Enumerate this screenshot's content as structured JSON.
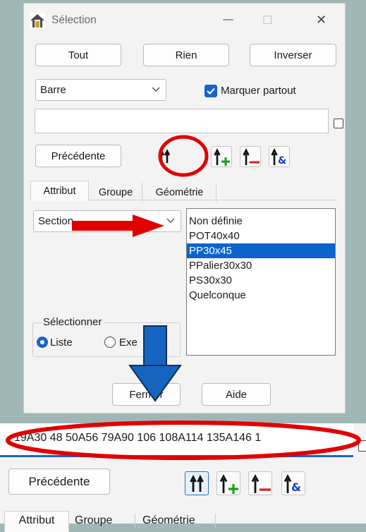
{
  "window": {
    "title": "Sélection",
    "controls": {
      "minimize": "—",
      "maximize": "☐",
      "close": "✕"
    }
  },
  "buttons": {
    "all": "Tout",
    "none": "Rien",
    "invert": "Inverser",
    "previous": "Précédente",
    "close": "Fermer",
    "help": "Aide"
  },
  "object_type": {
    "selected": "Barre"
  },
  "mark_everywhere": {
    "label": "Marquer partout",
    "checked": true
  },
  "selection_field": {
    "value": ""
  },
  "tabs": [
    {
      "label": "Attribut",
      "active": true
    },
    {
      "label": "Groupe",
      "active": false
    },
    {
      "label": "Géométrie",
      "active": false
    }
  ],
  "attribute": {
    "selected": "Section"
  },
  "values_list": {
    "items": [
      "Non définie",
      "POT40x40",
      "PP30x45",
      "PPalier30x30",
      "PS30x30",
      "Quelconque"
    ],
    "selected_index": 2
  },
  "select_mode": {
    "group_label": "Sélectionner",
    "options": [
      "Liste",
      "Exe"
    ],
    "selected": "Liste"
  },
  "zoom": {
    "field_value": "19A30 48 50A56 79A90 106 108A114 135A146 1",
    "previous": "Précédente",
    "tabs": [
      "Attribut",
      "Groupe",
      "Géométrie"
    ]
  },
  "colors": {
    "annotation_red": "#e00000",
    "annotation_blue": "#1565c0",
    "selected_blue": "#0a64cc",
    "plus_green": "#1e9c1e",
    "minus_red": "#d42020",
    "amp_blue": "#1a3ccc"
  }
}
